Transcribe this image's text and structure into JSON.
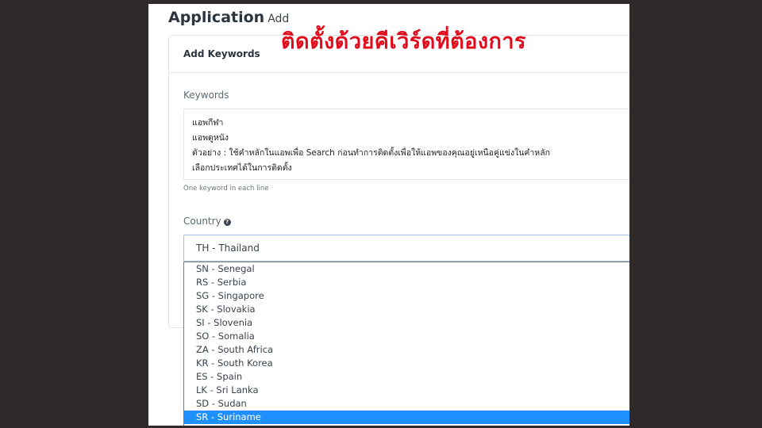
{
  "header": {
    "title": "Application",
    "subtitle": "Add"
  },
  "overlay": {
    "text": "ติดตั้งด้วยคีเวิร์ดที่ต้องการ",
    "color": "#e00a1b"
  },
  "card": {
    "title": "Add Keywords",
    "keywords": {
      "label": "Keywords",
      "lines": [
        "แอพกีฬา",
        "แอพดูหนัง",
        "ตัวอย่าง : ใช้คำหลักในแอพเพื่อ Search ก่อนทำการติดตั้งเพื่อให้แอพของคุณอยู่เหนือคู่แข่งในคำหลัก",
        "เลือกประเทศได้ในการติดตั้ง"
      ],
      "help": "One keyword in each line"
    },
    "country": {
      "label": "Country",
      "help_icon": "question-circle-icon",
      "selected": "TH - Thailand",
      "options": [
        "SN - Senegal",
        "RS - Serbia",
        "SG - Singapore",
        "SK - Slovakia",
        "SI - Slovenia",
        "SO - Somalia",
        "ZA - South Africa",
        "KR - South Korea",
        "ES - Spain",
        "LK - Sri Lanka",
        "SD - Sudan",
        "SR - Suriname"
      ],
      "highlighted": "SR - Suriname"
    }
  },
  "colors": {
    "highlight": "#1e90ff",
    "background": "#2d2a29",
    "focus_border": "#9fc3e8"
  }
}
